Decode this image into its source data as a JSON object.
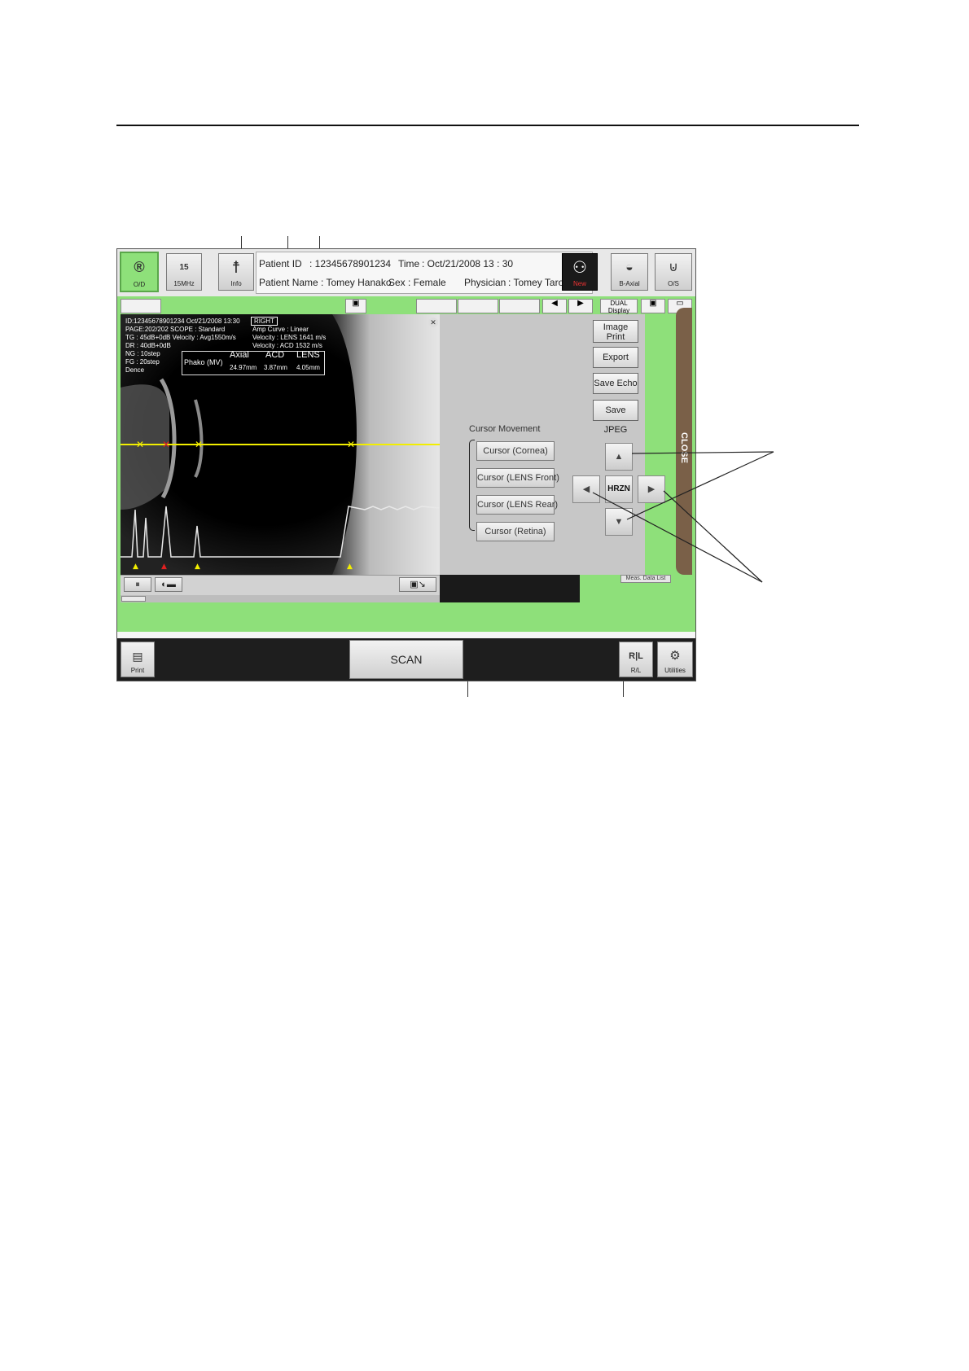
{
  "header": {
    "od_label": "O/D",
    "freq_label": "15MHz",
    "freq_value": "15",
    "info_label": "Info",
    "patient_id_label": "Patient ID",
    "patient_id_value": ": 12345678901234",
    "time_label": "Time",
    "time_value": ": Oct/21/2008  13 : 30",
    "patient_name_label": "Patient Name",
    "patient_name_value": ": Tomey Hanako",
    "sex_label": "Sex",
    "sex_value": ": Female",
    "physician_label": "Physician",
    "physician_value": ": Tomey Taro",
    "new_label": "New",
    "baxial_label": "B-Axial",
    "os_label": "O/S"
  },
  "tabs": {
    "dual_display": "DUAL Display"
  },
  "overlay": {
    "line1": "ID:12345678901234 Oct/21/2008  13:30",
    "side": "RIGHT",
    "line2": "PAGE:202/202  SCOPE :  Standard",
    "amp_curve": "Amp Curve :  Linear",
    "line3": "TG  : 45dB+0dB Velocity : Avg1550m/s",
    "vel_lens": "Velocity : LENS 1641 m/s",
    "line4": "DR  : 40dB+0dB",
    "vel_acd": "Velocity : ACD  1532 m/s",
    "line5": "NG  : 10step",
    "line6": "FG  : 20step",
    "line7": "Dence"
  },
  "measurements": {
    "mode": "Phako (MV)",
    "headers": [
      "Axial",
      "ACD",
      "LENS"
    ],
    "values": [
      "24.97mm",
      "3.87mm",
      "4.05mm"
    ]
  },
  "right_panel": {
    "image_print": "Image Print",
    "export": "Export",
    "save_echo": "Save Echo",
    "save_jpeg": "Save JPEG",
    "cursor_movement": "Cursor Movement",
    "cursor_cornea": "Cursor (Cornea)",
    "cursor_lens_front": "Cursor (LENS Front)",
    "cursor_lens_rear": "Cursor (LENS Rear)",
    "cursor_retina": "Cursor (Retina)",
    "hrzn": "HRZN",
    "close": "CLOSE",
    "meas_data_list": "Meas. Data List"
  },
  "bottom": {
    "print": "Print",
    "scan": "SCAN",
    "rl": "R/L",
    "utilities": "Utilities"
  },
  "colors": {
    "frame_green": "#8ee07a",
    "cursor_yellow": "#f2ee00",
    "cursor_red": "#e02020",
    "close_brown": "#7a6048"
  }
}
